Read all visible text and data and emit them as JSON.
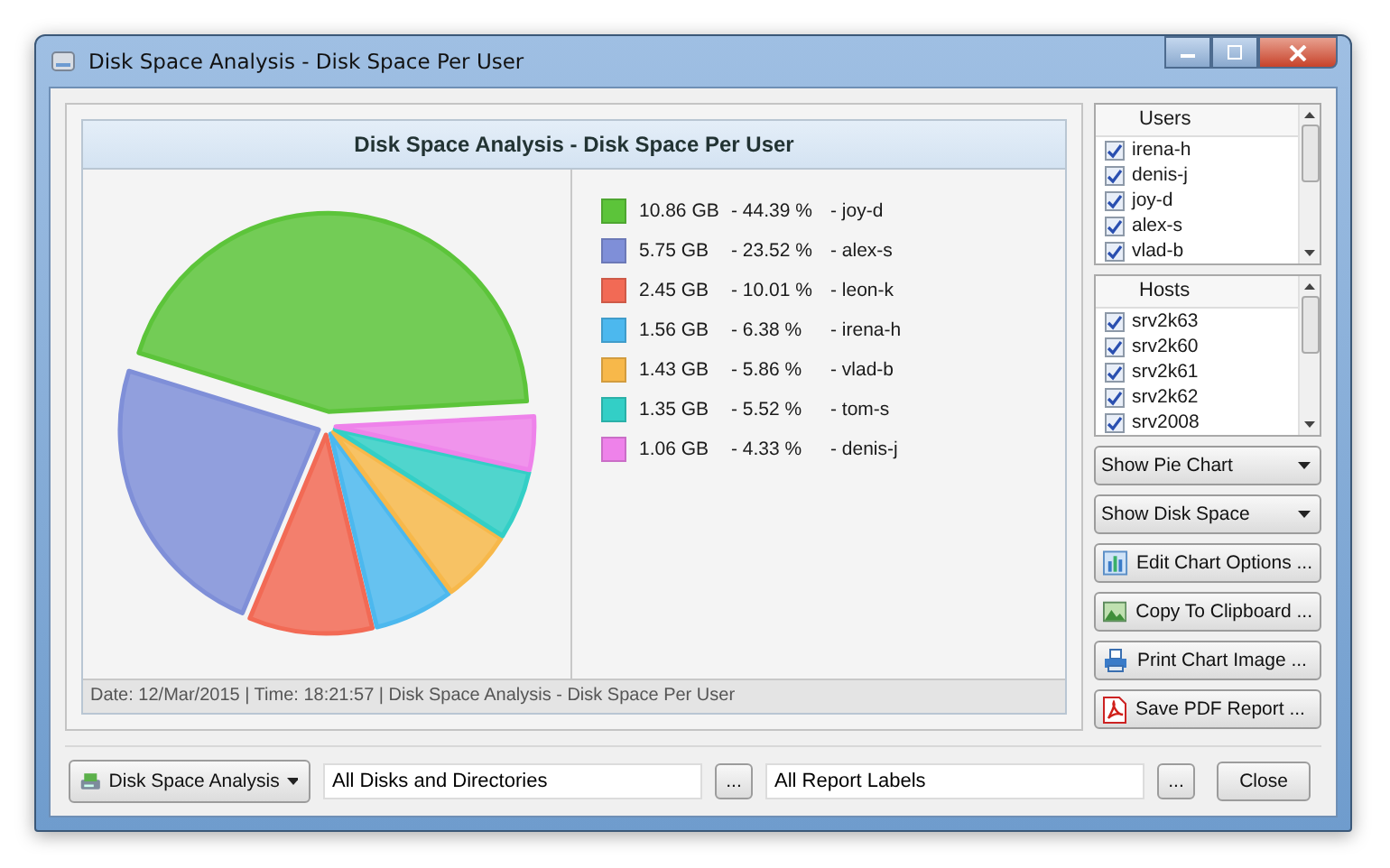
{
  "window": {
    "title": "Disk Space Analysis - Disk Space Per User"
  },
  "chart": {
    "title": "Disk Space Analysis - Disk Space Per User",
    "chart_data": {
      "type": "pie",
      "categories": [
        "- joy-d",
        "- alex-s",
        "- leon-k",
        "- irena-h",
        "- vlad-b",
        "- tom-s",
        "- denis-j"
      ],
      "values": [
        44.39,
        23.52,
        10.01,
        6.38,
        5.86,
        5.52,
        4.33
      ]
    },
    "legend": [
      {
        "size": "10.86 GB",
        "percent": "- 44.39 %",
        "color": "#5cc43a"
      },
      {
        "size": "5.75 GB",
        "percent": "- 23.52 %",
        "color": "#7f8fd8"
      },
      {
        "size": "2.45 GB",
        "percent": "- 10.01 %",
        "color": "#f26a55"
      },
      {
        "size": "1.56 GB",
        "percent": "- 6.38 %",
        "color": "#4cb8ee"
      },
      {
        "size": "1.43 GB",
        "percent": "- 5.86 %",
        "color": "#f7b84a"
      },
      {
        "size": "1.35 GB",
        "percent": "- 5.52 %",
        "color": "#33cfc6"
      },
      {
        "size": "1.06 GB",
        "percent": "- 4.33 %",
        "color": "#ee82ea"
      }
    ],
    "footer": "Date: 12/Mar/2015 | Time: 18:21:57 | Disk Space Analysis - Disk Space Per User"
  },
  "users": {
    "header": "Users",
    "items": [
      {
        "label": "irena-h",
        "checked": true
      },
      {
        "label": "denis-j",
        "checked": true
      },
      {
        "label": "joy-d",
        "checked": true
      },
      {
        "label": "alex-s",
        "checked": true
      },
      {
        "label": "vlad-b",
        "checked": true
      }
    ]
  },
  "hosts": {
    "header": "Hosts",
    "items": [
      {
        "label": "srv2k63",
        "checked": true
      },
      {
        "label": "srv2k60",
        "checked": true
      },
      {
        "label": "srv2k61",
        "checked": true
      },
      {
        "label": "srv2k62",
        "checked": true
      },
      {
        "label": "srv2008",
        "checked": true
      }
    ]
  },
  "dropdowns": [
    "Show Pie Chart",
    "Show Disk Space"
  ],
  "buttons": [
    {
      "label": "Edit Chart Options ...",
      "kind": "chart"
    },
    {
      "label": "Copy To Clipboard ...",
      "kind": "clipboard"
    },
    {
      "label": "Print Chart Image ...",
      "kind": "print"
    },
    {
      "label": "Save PDF Report ...",
      "kind": "pdf"
    }
  ],
  "bottom": {
    "analysis": "Disk Space Analysis",
    "disks": "All Disks and Directories",
    "browse_1": "...",
    "labels": "All Report Labels",
    "browse_2": "...",
    "close": "Close"
  }
}
